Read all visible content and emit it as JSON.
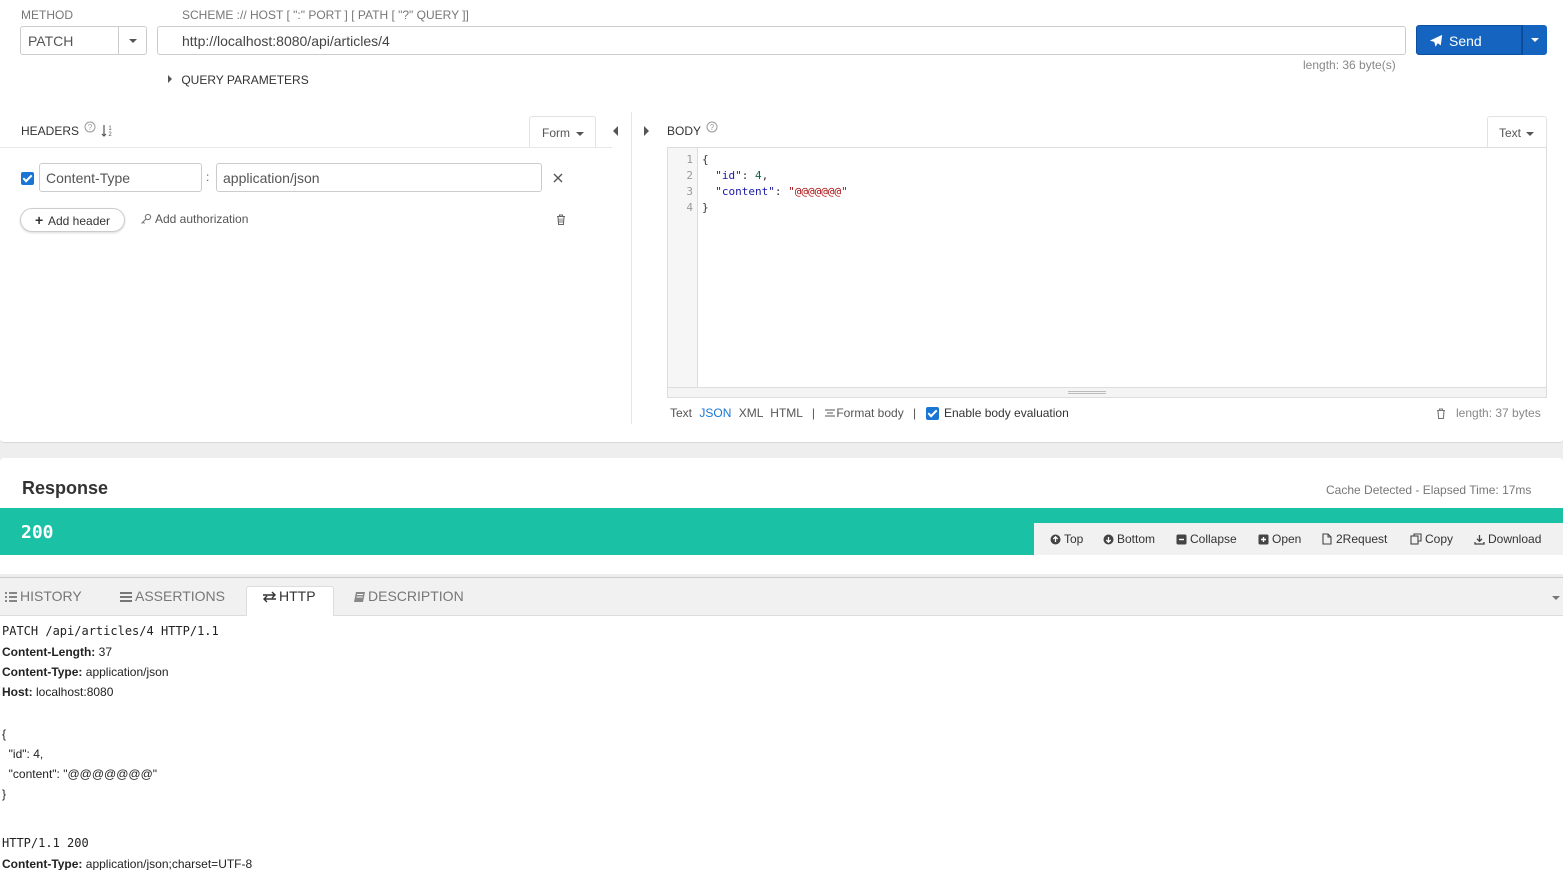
{
  "request": {
    "method_label": "METHOD",
    "method_value": "PATCH",
    "url_label": "SCHEME :// HOST [ \":\" PORT ] [ PATH [ \"?\" QUERY ]]",
    "url_value": "http://localhost:8080/api/articles/4",
    "send_label": "Send",
    "url_length": "length: 36 byte(s)",
    "query_params_label": "QUERY PARAMETERS"
  },
  "headers": {
    "title": "HEADERS",
    "mode": "Form",
    "rows": [
      {
        "name": "Content-Type",
        "separator": ":",
        "value": "application/json"
      }
    ],
    "add_header": "Add header",
    "add_auth": "Add authorization"
  },
  "body": {
    "title": "BODY",
    "mode": "Text",
    "lines": [
      "1",
      "2",
      "3",
      "4"
    ],
    "code": {
      "l1": "{",
      "l2_key": "\"id\"",
      "l2_sep": ": ",
      "l2_val": "4",
      "l2_end": ",",
      "l3_key": "\"content\"",
      "l3_sep": ": ",
      "l3_val": "\"@@@@@@@\"",
      "l4": "}"
    },
    "formats": [
      "Text",
      "JSON",
      "XML",
      "HTML"
    ],
    "divider": "|",
    "format_body": "Format body",
    "enable_eval": "Enable body evaluation",
    "length": "length: 37 bytes"
  },
  "response": {
    "title": "Response",
    "meta": "Cache Detected - Elapsed Time: 17ms",
    "status": "200",
    "tools": [
      "Top",
      "Bottom",
      "Collapse",
      "Open",
      "2Request",
      "Copy",
      "Download"
    ]
  },
  "tabs": {
    "history": "HISTORY",
    "assertions": "ASSERTIONS",
    "http": "HTTP",
    "description": "DESCRIPTION"
  },
  "http": {
    "request_line": "PATCH /api/articles/4 HTTP/1.1",
    "req_headers": [
      {
        "k": "Content-Length:",
        "v": " 37"
      },
      {
        "k": "Content-Type:",
        "v": " application/json"
      },
      {
        "k": "Host:",
        "v": " localhost:8080"
      }
    ],
    "body_lines": [
      "{",
      "  \"id\": 4,",
      "  \"content\": \"@@@@@@@\"",
      "}"
    ],
    "response_line": "HTTP/1.1 200",
    "resp_headers": [
      {
        "k": "Content-Type:",
        "v": " application/json;charset=UTF-8"
      }
    ]
  },
  "colors": {
    "accent": "#1565c0",
    "status_ok": "#1bc1a4"
  }
}
